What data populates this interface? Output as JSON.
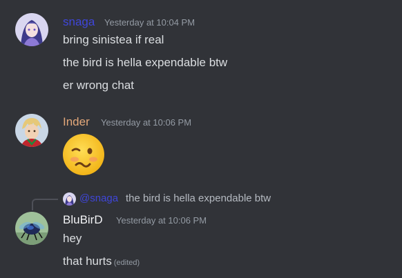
{
  "messages": [
    {
      "author": "snaga",
      "author_color": "#3f46d9",
      "avatar": "anime-girl-avatar",
      "timestamp": "Yesterday at 10:04 PM",
      "lines": [
        "bring sinistea if real",
        "the bird is hella expendable btw",
        "er wrong chat"
      ]
    },
    {
      "author": "Inder",
      "author_color": "#e3a87a",
      "avatar": "anime-boy-avatar",
      "timestamp": "Yesterday at 10:06 PM",
      "emoji": "woozy-face-emoji"
    },
    {
      "author": "BluBirD",
      "author_color": "#f2f3f5",
      "avatar": "bee-avatar",
      "timestamp": "Yesterday at 10:06 PM",
      "reply": {
        "author": "@snaga",
        "text": "the bird is hella expendable btw"
      },
      "lines": [
        "hey",
        "that hurts"
      ],
      "edited_label": "(edited)"
    }
  ]
}
